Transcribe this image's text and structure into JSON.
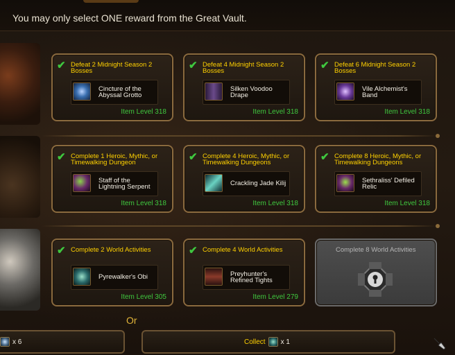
{
  "header": {
    "message": "You may only select ONE reward from the Great Vault."
  },
  "rows": [
    {
      "category": "raid",
      "cards": [
        {
          "condition": "Defeat 2 Midnight Season 2 Bosses",
          "completed": true,
          "item": {
            "name": "Cincture of the Abyssal Grotto",
            "icon": "belt-icon",
            "icon_color": "#3a6fb0"
          },
          "item_level": "Item Level 318"
        },
        {
          "condition": "Defeat 4 Midnight Season 2 Bosses",
          "completed": true,
          "item": {
            "name": "Silken Voodoo Drape",
            "icon": "cloak-icon",
            "icon_color": "#5a3a7a"
          },
          "item_level": "Item Level 318"
        },
        {
          "condition": "Defeat 6 Midnight Season 2 Bosses",
          "completed": true,
          "item": {
            "name": "Vile Alchemist's Band",
            "icon": "ring-icon",
            "icon_color": "#6a3a9a"
          },
          "item_level": "Item Level 318"
        }
      ]
    },
    {
      "category": "dungeon",
      "cards": [
        {
          "condition": "Complete 1 Heroic, Mythic, or Timewalking Dungeon",
          "completed": true,
          "item": {
            "name": "Staff of the Lightning Serpent",
            "icon": "staff-icon",
            "icon_color": "#6a2a6a"
          },
          "item_level": "Item Level 318"
        },
        {
          "condition": "Complete 4 Heroic, Mythic, or Timewalking Dungeons",
          "completed": true,
          "item": {
            "name": "Crackling Jade Kilij",
            "icon": "sword-icon",
            "icon_color": "#2a5a6a"
          },
          "item_level": "Item Level 318"
        },
        {
          "condition": "Complete 8 Heroic, Mythic, or Timewalking Dungeons",
          "completed": true,
          "item": {
            "name": "Sethraliss' Defiled Relic",
            "icon": "relic-icon",
            "icon_color": "#6a2a6a"
          },
          "item_level": "Item Level 318"
        }
      ]
    },
    {
      "category": "world",
      "cards": [
        {
          "condition": "Complete 2 World Activities",
          "completed": true,
          "item": {
            "name": "Pyrewalker's Obi",
            "icon": "obi-icon",
            "icon_color": "#2a6a6a"
          },
          "item_level": "Item Level 305"
        },
        {
          "condition": "Complete 4 World Activities",
          "completed": true,
          "item": {
            "name": "Preyhunter's Refined Tights",
            "icon": "leggings-icon",
            "icon_color": "#7a3a2a"
          },
          "item_level": "Item Level 279"
        },
        {
          "condition": "Complete 8 World Activities",
          "completed": false,
          "locked": true
        }
      ]
    }
  ],
  "or_text": "Or",
  "footer": {
    "left_qty": "x 6",
    "collect_label": "Collect",
    "collect_qty": "x 1"
  },
  "colors": {
    "condition_text": "#ffd100",
    "item_level_text": "#3fc83f",
    "card_border": "#8a6a3e"
  }
}
